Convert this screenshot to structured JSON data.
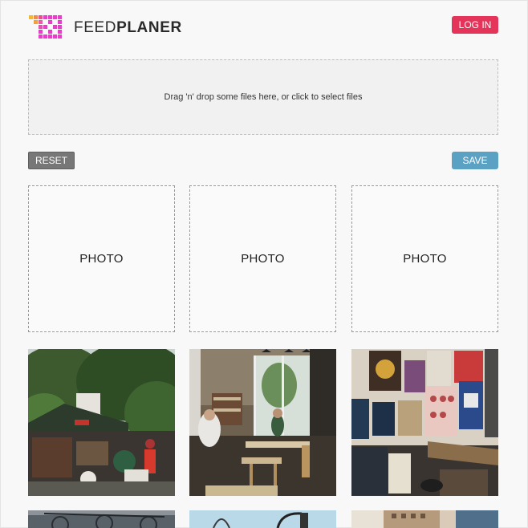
{
  "header": {
    "brand_light": "FEED",
    "brand_bold": "PLANER",
    "logo_icon": "pixel-grid-logo",
    "login_label": "LOG IN"
  },
  "dropzone": {
    "text": "Drag 'n' drop some files here, or click to select files"
  },
  "actions": {
    "reset_label": "RESET",
    "save_label": "SAVE"
  },
  "placeholders": [
    {
      "label": "PHOTO"
    },
    {
      "label": "PHOTO"
    },
    {
      "label": "PHOTO"
    }
  ],
  "colors": {
    "login": "#e5345a",
    "save": "#5aa1c3",
    "reset": "#777777",
    "logo_pink": "#e83ec9",
    "logo_orange": "#f5a623"
  }
}
